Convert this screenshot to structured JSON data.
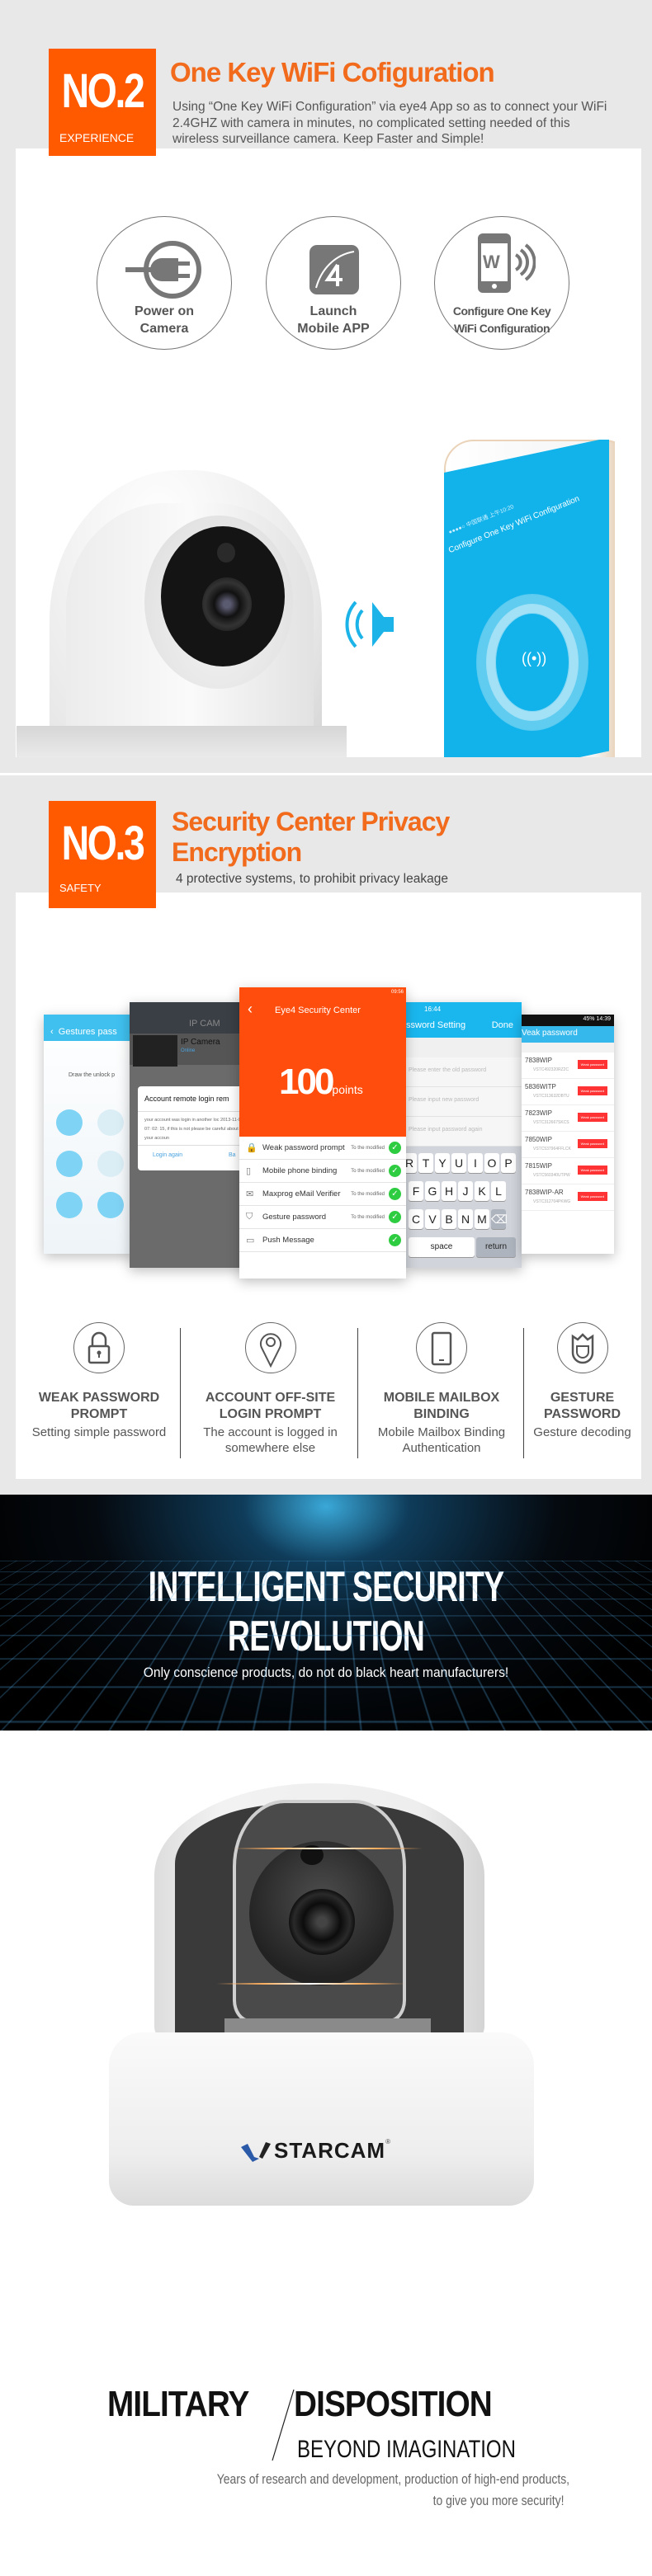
{
  "section1": {
    "badge_number": "NO.2",
    "badge_label": "EXPERIENCE",
    "title": "One Key WiFi Cofiguration",
    "description": "Using “One Key WiFi Configuration” via eye4 App so as to connect your WiFi 2.4GHZ with camera in minutes, no complicated setting needed of this wireless surveillance camera. Keep Faster and Simple!",
    "steps": [
      {
        "icon": "power-plug-icon",
        "label_line1": "Power on",
        "label_line2": "Camera"
      },
      {
        "icon": "eye4-app-icon",
        "label_line1": "Launch",
        "label_line2": "Mobile APP"
      },
      {
        "icon": "phone-wifi-icon",
        "label_line1": "Configure One Key",
        "label_line2": "WiFi Configuration"
      }
    ],
    "phone_screen": {
      "status": "●●●●○ 中国联通 上午10:20",
      "title": "Configure One Key WiFi Configuration"
    },
    "accent": "#00b4ef"
  },
  "section2": {
    "badge_number": "NO.3",
    "badge_label": "SAFETY",
    "title_line1": "Security Center Privacy",
    "title_line2": "Encryption",
    "subtitle": "4 protective systems, to prohibit privacy leakage",
    "screens": {
      "gesture": {
        "title": "Gestures pass",
        "hint": "Draw the unlock p"
      },
      "remote": {
        "header": "IP CAM",
        "camera": "IP Camera",
        "status": "Online",
        "dialog_title": "Account remote login rem",
        "dialog_body": "your account was login in another loc 2013-11-01 07: 02: 15, if this is not please be careful about your accoun",
        "login_again": "Login again",
        "back": "Ba"
      },
      "center": {
        "status_time": "09:56",
        "title": "Eye4 Security Center",
        "score": "100",
        "score_unit": "points",
        "items": [
          {
            "label": "Weak password prompt",
            "state": "To the modified",
            "icon": "lock-icon"
          },
          {
            "label": "Mobile phone binding",
            "state": "To the modified",
            "icon": "phone-icon"
          },
          {
            "label": "Maxprog eMail Verifier",
            "state": "To the modified",
            "icon": "mail-icon"
          },
          {
            "label": "Gesture password",
            "state": "To the modified",
            "icon": "shield-icon"
          },
          {
            "label": "Push Message",
            "state": "",
            "icon": "message-icon"
          }
        ]
      },
      "password": {
        "time": "16:44",
        "title": "ssword Setting",
        "done": "Done",
        "fields": [
          "Please enter the old password",
          "Please input new password",
          "Please input password again"
        ],
        "keys_row1": [
          "R",
          "T",
          "Y",
          "U",
          "I",
          "O",
          "P"
        ],
        "keys_row2": [
          "F",
          "G",
          "H",
          "J",
          "K",
          "L"
        ],
        "keys_row3": [
          "C",
          "V",
          "B",
          "N",
          "M"
        ],
        "space": "space",
        "return": "return"
      },
      "weak": {
        "status": "45% 14:39",
        "title": "Veak password",
        "tag": "Weak password",
        "devices": [
          {
            "name": "7838WIP",
            "id": "VSTC492320RZ2C"
          },
          {
            "name": "5836WITP",
            "id": "VSTC313632DBTU"
          },
          {
            "name": "7823WIP",
            "id": "VSTC312667SKCS"
          },
          {
            "name": "7850WIP",
            "id": "VSTC537964FFLCK"
          },
          {
            "name": "7815WIP",
            "id": "VSTC560340UTPW"
          },
          {
            "name": "7838WIP-AR",
            "id": "VSTC312704PKWG"
          }
        ]
      }
    },
    "features": [
      {
        "icon": "padlock-icon",
        "title_line1": "WEAK PASSWORD",
        "title_line2": "PROMPT",
        "desc_line1": "Setting simple password",
        "desc_line2": ""
      },
      {
        "icon": "location-pin-icon",
        "title_line1": "ACCOUNT OFF-SITE",
        "title_line2": "LOGIN PROMPT",
        "desc_line1": "The account is logged in",
        "desc_line2": "somewhere else"
      },
      {
        "icon": "mobile-phone-icon",
        "title_line1": "MOBILE MAILBOX",
        "title_line2": "BINDING",
        "desc_line1": "Mobile Mailbox Binding",
        "desc_line2": "Authentication"
      },
      {
        "icon": "shield-icon",
        "title_line1": "GESTURE",
        "title_line2": "PASSWORD",
        "desc_line1": "Gesture decoding",
        "desc_line2": ""
      }
    ],
    "accent": "#ff5a00"
  },
  "banner": {
    "title_line1": "INTELLIGENT SECURITY",
    "title_line2": "REVOLUTION",
    "subtitle": "Only conscience products, do not do black heart manufacturers!"
  },
  "product": {
    "brand": "STARCAM",
    "trademark": "®"
  },
  "military": {
    "title_left": "MILITARY",
    "title_right": "DISPOSITION",
    "subtitle": "BEYOND IMAGINATION",
    "desc_line1": "Years of research and development, production of high-end products,",
    "desc_line2": "to give you more security!"
  }
}
